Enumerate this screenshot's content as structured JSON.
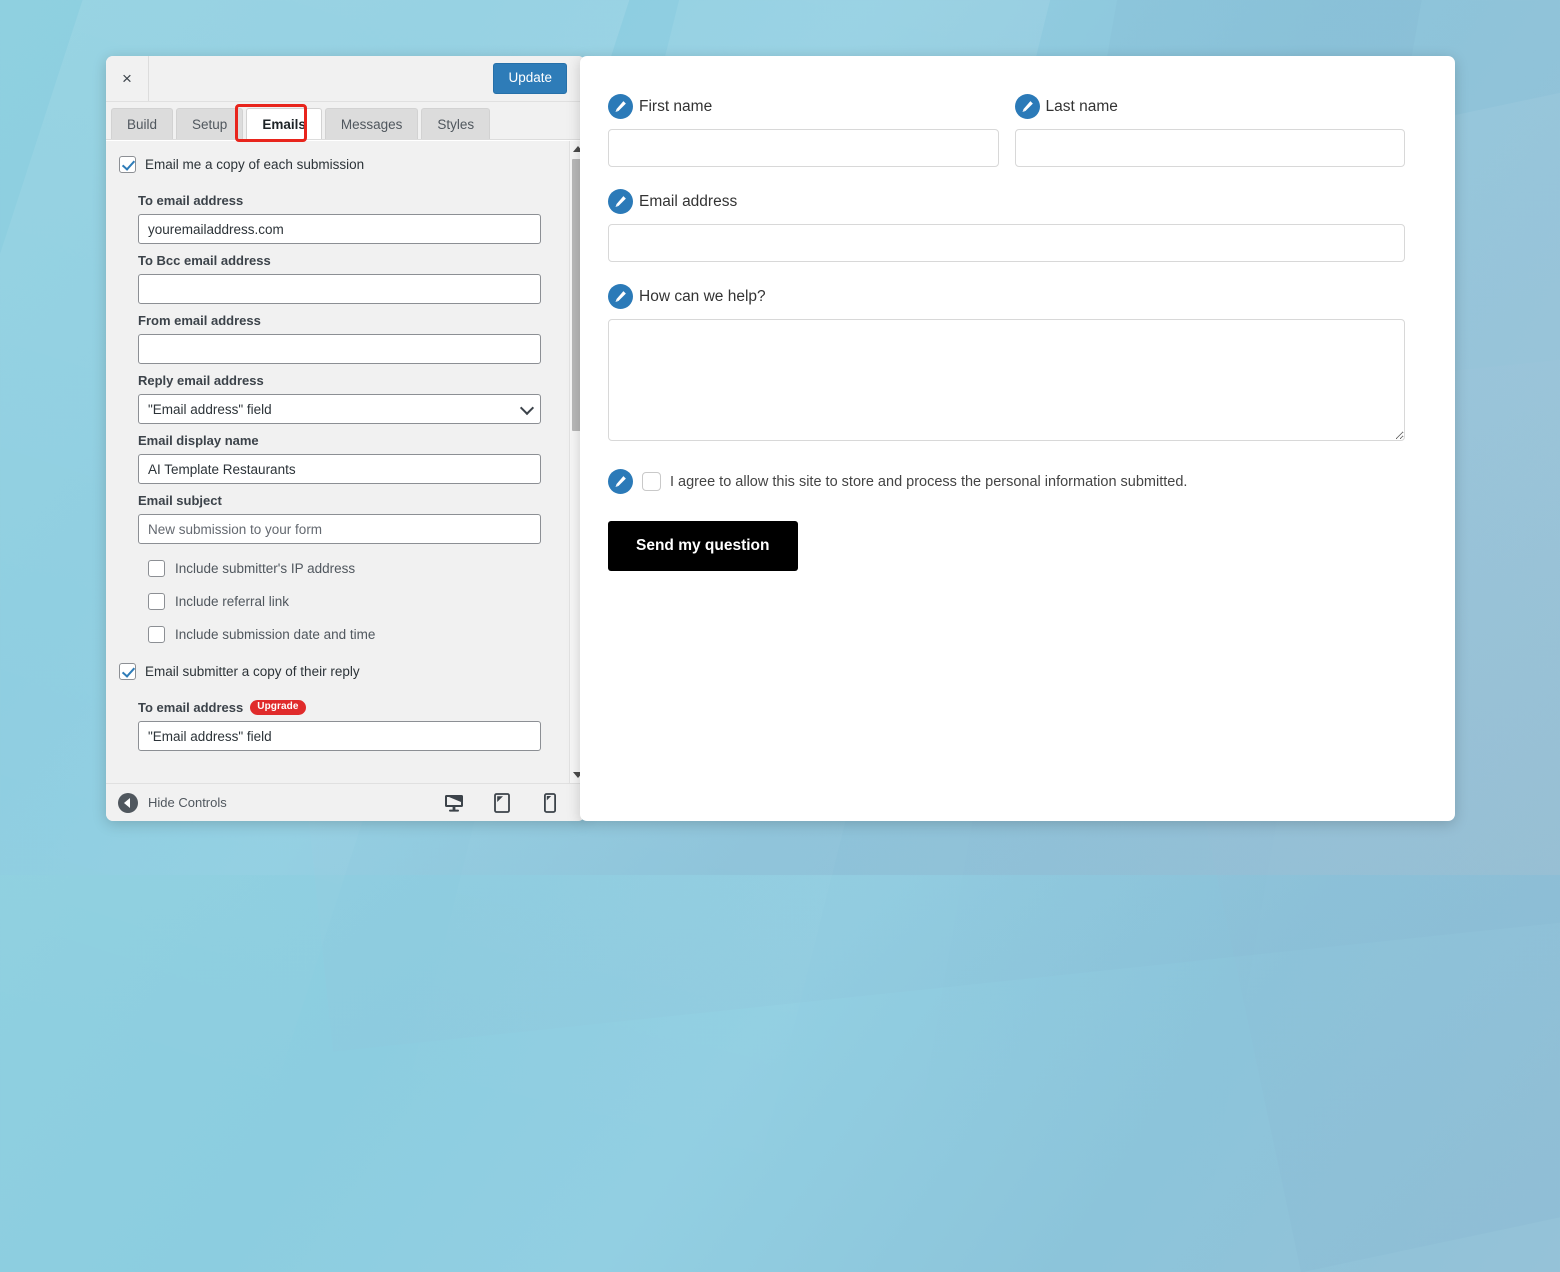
{
  "builder": {
    "close_label": "×",
    "update_label": "Update",
    "tabs": [
      {
        "label": "Build",
        "active": false
      },
      {
        "label": "Setup",
        "active": false
      },
      {
        "label": "Emails",
        "active": true,
        "highlighted": true
      },
      {
        "label": "Messages",
        "active": false
      },
      {
        "label": "Styles",
        "active": false
      }
    ],
    "emails_tab": {
      "admin_notification": {
        "toggle_label": "Email me a copy of each submission",
        "toggle_checked": true,
        "fields": [
          {
            "label": "To email address",
            "value": "youremailaddress.com",
            "type": "text"
          },
          {
            "label": "To Bcc email address",
            "value": "",
            "type": "text"
          },
          {
            "label": "From email address",
            "value": "",
            "type": "text"
          },
          {
            "label": "Reply email address",
            "value": "\"Email address\" field",
            "type": "select"
          },
          {
            "label": "Email display name",
            "value": "AI Template Restaurants",
            "type": "text"
          },
          {
            "label": "Email subject",
            "value": "New submission to your form",
            "type": "text"
          }
        ],
        "options": [
          {
            "label": "Include submitter's IP address",
            "checked": false
          },
          {
            "label": "Include referral link",
            "checked": false
          },
          {
            "label": "Include submission date and time",
            "checked": false
          }
        ]
      },
      "submitter_notification": {
        "toggle_label": "Email submitter a copy of their reply",
        "toggle_checked": true,
        "to_email_label": "To email address",
        "to_email_badge": "Upgrade",
        "to_email_value": "\"Email address\" field"
      }
    },
    "footer": {
      "hide_controls_label": "Hide Controls",
      "devices": [
        {
          "name": "desktop-preview",
          "title": "Desktop"
        },
        {
          "name": "tablet-preview",
          "title": "Tablet"
        },
        {
          "name": "mobile-preview",
          "title": "Mobile"
        }
      ]
    }
  },
  "preview": {
    "fields": [
      {
        "label": "First name",
        "value": "",
        "type": "text"
      },
      {
        "label": "Last name",
        "value": "",
        "type": "text"
      },
      {
        "label": "Email address",
        "value": "",
        "type": "text"
      },
      {
        "label": "How can we help?",
        "value": "",
        "type": "textarea"
      }
    ],
    "consent": {
      "label": "I agree to allow this site to store and process the personal information submitted.",
      "checked": false
    },
    "submit_label": "Send my question"
  },
  "colors": {
    "accent_blue": "#2e7cb8",
    "pencil_blue": "#2b7ab8",
    "highlight_red": "#e8241c",
    "badge_red": "#e02b2b",
    "submit_black": "#000000",
    "panel_grey": "#f1f1f1",
    "desktop_bg": "#8ccde0"
  }
}
